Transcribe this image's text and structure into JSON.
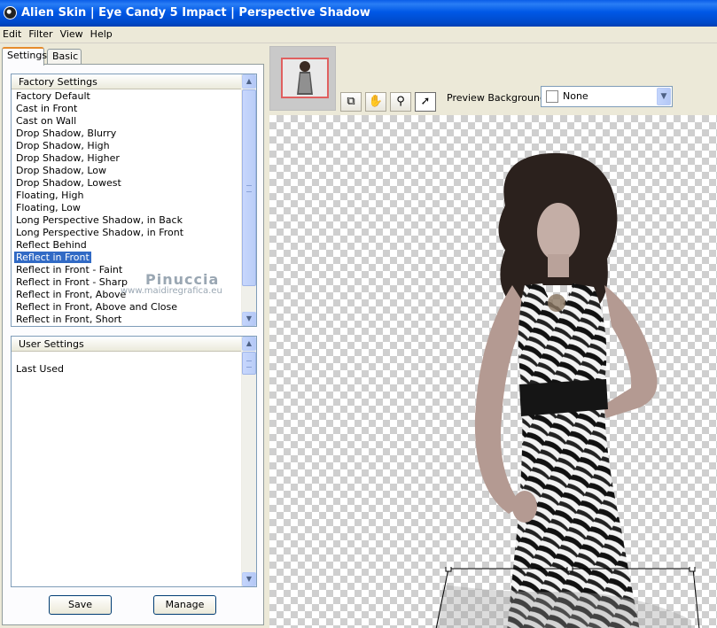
{
  "window": {
    "title": "Alien Skin | Eye Candy 5 Impact | Perspective Shadow"
  },
  "menu": [
    "Edit",
    "Filter",
    "View",
    "Help"
  ],
  "tabs": [
    {
      "label": "Settings",
      "active": true
    },
    {
      "label": "Basic",
      "active": false
    }
  ],
  "factory_settings": {
    "header": "Factory Settings",
    "items": [
      "Factory Default",
      "Cast in Front",
      "Cast on Wall",
      "Drop Shadow, Blurry",
      "Drop Shadow, High",
      "Drop Shadow, Higher",
      "Drop Shadow, Low",
      "Drop Shadow, Lowest",
      "Floating, High",
      "Floating, Low",
      "Long Perspective Shadow, in Back",
      "Long Perspective Shadow, in Front",
      "Reflect Behind",
      "Reflect in Front",
      "Reflect in Front - Faint",
      "Reflect in Front - Sharp",
      "Reflect in Front, Above",
      "Reflect in Front, Above and Close",
      "Reflect in Front, Short"
    ],
    "selected": "Reflect in Front"
  },
  "user_settings": {
    "header": "User Settings",
    "items": [
      "Last Used"
    ]
  },
  "buttons": {
    "save": "Save",
    "manage": "Manage"
  },
  "watermark": {
    "name": "Pinuccia",
    "url": "www.maidiregrafica.eu"
  },
  "preview": {
    "background_label": "Preview Background:",
    "background_value": "None"
  },
  "tools": [
    "preview-toggle-icon",
    "hand-icon",
    "zoom-icon",
    "arrow-icon"
  ],
  "colors": {
    "title_bar": "#0058e6",
    "selection": "#316ac5",
    "active_tab_accent": "#e68b2c"
  }
}
